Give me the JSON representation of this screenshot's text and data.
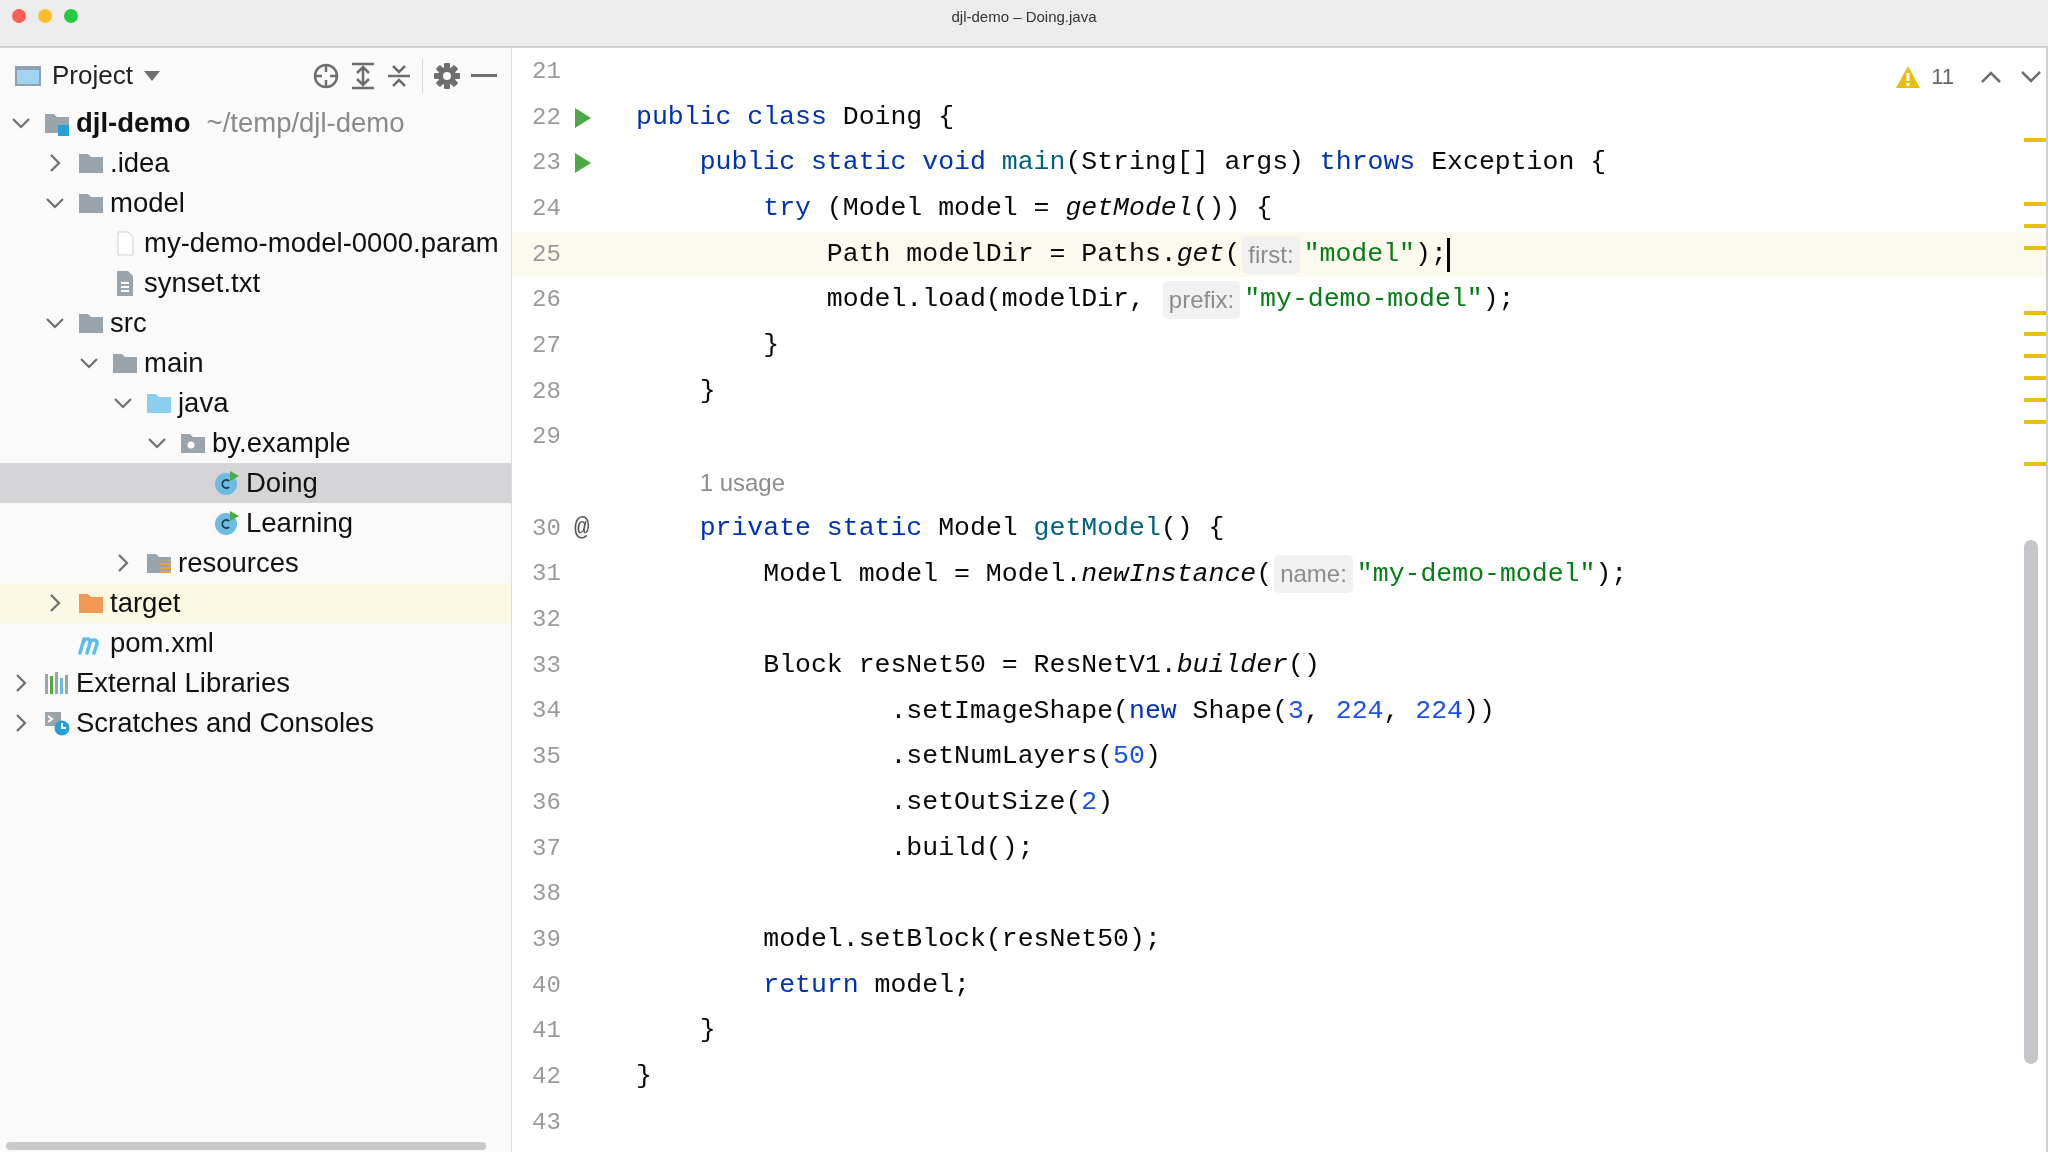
{
  "window": {
    "title": "djl-demo – Doing.java"
  },
  "project_panel": {
    "title": "Project",
    "tree": [
      {
        "label": "djl-demo",
        "kind": "module",
        "detail": "~/temp/djl-demo",
        "expanded": true,
        "selected": false,
        "highlighted": false,
        "children": [
          {
            "label": ".idea",
            "kind": "folder",
            "expanded": false,
            "selected": false,
            "highlighted": false
          },
          {
            "label": "model",
            "kind": "folder",
            "expanded": true,
            "selected": false,
            "highlighted": false,
            "children": [
              {
                "label": "my-demo-model-0000.param",
                "kind": "file",
                "selected": false,
                "highlighted": false
              },
              {
                "label": "synset.txt",
                "kind": "text-file",
                "selected": false,
                "highlighted": false
              }
            ]
          },
          {
            "label": "src",
            "kind": "folder",
            "expanded": true,
            "selected": false,
            "highlighted": false,
            "children": [
              {
                "label": "main",
                "kind": "folder",
                "expanded": true,
                "selected": false,
                "highlighted": false,
                "children": [
                  {
                    "label": "java",
                    "kind": "source-folder",
                    "expanded": true,
                    "selected": false,
                    "highlighted": false,
                    "children": [
                      {
                        "label": "by.example",
                        "kind": "package",
                        "expanded": true,
                        "selected": false,
                        "highlighted": false,
                        "children": [
                          {
                            "label": "Doing",
                            "kind": "class",
                            "selected": true,
                            "highlighted": false
                          },
                          {
                            "label": "Learning",
                            "kind": "class",
                            "selected": false,
                            "highlighted": false
                          }
                        ]
                      }
                    ]
                  },
                  {
                    "label": "resources",
                    "kind": "resources-folder",
                    "expanded": false,
                    "selected": false,
                    "highlighted": false
                  }
                ]
              }
            ]
          },
          {
            "label": "target",
            "kind": "excluded-folder",
            "expanded": false,
            "selected": false,
            "highlighted": true
          },
          {
            "label": "pom.xml",
            "kind": "maven",
            "selected": false,
            "highlighted": false
          }
        ]
      },
      {
        "label": "External Libraries",
        "kind": "libraries",
        "expanded": false,
        "selected": false,
        "highlighted": false
      },
      {
        "label": "Scratches and Consoles",
        "kind": "scratches",
        "expanded": false,
        "selected": false,
        "highlighted": false
      }
    ]
  },
  "editor": {
    "warnings": {
      "count": "11"
    },
    "lines": [
      {
        "kind": "code",
        "number": "21"
      },
      {
        "kind": "code",
        "number": "22",
        "gutter": {
          "kind": "run"
        },
        "segments": [
          {
            "kind": "code",
            "tokens": [
              {
                "kind": "kw",
                "t": "public class"
              },
              {
                "kind": "plain",
                "t": " Doing {"
              }
            ]
          }
        ]
      },
      {
        "kind": "code",
        "number": "23",
        "gutter": {
          "kind": "run"
        },
        "segments": [
          {
            "kind": "code",
            "tokens": [
              {
                "kind": "kw",
                "t": "    public static void "
              },
              {
                "kind": "fn",
                "t": "main"
              },
              {
                "kind": "plain",
                "t": "(String[] args) "
              },
              {
                "kind": "kw",
                "t": "throws"
              },
              {
                "kind": "plain",
                "t": " Exception {"
              }
            ]
          }
        ]
      },
      {
        "kind": "code",
        "number": "24",
        "segments": [
          {
            "kind": "code",
            "tokens": [
              {
                "kind": "kw",
                "t": "        try"
              },
              {
                "kind": "plain",
                "t": " (Model model = "
              },
              {
                "kind": "italic",
                "t": "getModel"
              },
              {
                "kind": "plain",
                "t": "()) {"
              }
            ]
          }
        ]
      },
      {
        "kind": "code",
        "number": "25",
        "current": true,
        "caret": true,
        "segments": [
          {
            "kind": "code",
            "tokens": [
              {
                "kind": "plain",
                "t": "            Path modelDir = Paths."
              },
              {
                "kind": "italic",
                "t": "get"
              },
              {
                "kind": "plain",
                "t": "("
              }
            ]
          },
          {
            "kind": "hint",
            "text": "first:"
          },
          {
            "kind": "code",
            "tokens": [
              {
                "kind": "str",
                "t": "\"model\""
              },
              {
                "kind": "plain",
                "t": ");"
              }
            ]
          }
        ]
      },
      {
        "kind": "code",
        "number": "26",
        "segments": [
          {
            "kind": "code",
            "tokens": [
              {
                "kind": "plain",
                "t": "            model.load(modelDir, "
              }
            ]
          },
          {
            "kind": "hint",
            "text": "prefix:"
          },
          {
            "kind": "code",
            "tokens": [
              {
                "kind": "str",
                "t": "\"my-demo-model\""
              },
              {
                "kind": "plain",
                "t": ");"
              }
            ]
          }
        ]
      },
      {
        "kind": "code",
        "number": "27",
        "segments": [
          {
            "kind": "code",
            "tokens": [
              {
                "kind": "plain",
                "t": "        }"
              }
            ]
          }
        ]
      },
      {
        "kind": "code",
        "number": "28",
        "segments": [
          {
            "kind": "code",
            "tokens": [
              {
                "kind": "plain",
                "t": "    }"
              }
            ]
          }
        ]
      },
      {
        "kind": "code",
        "number": "29"
      },
      {
        "kind": "usage",
        "text": "    1 usage"
      },
      {
        "kind": "code",
        "number": "30",
        "gutter": {
          "kind": "text",
          "text": "@"
        },
        "segments": [
          {
            "kind": "code",
            "tokens": [
              {
                "kind": "kw",
                "t": "    private static"
              },
              {
                "kind": "plain",
                "t": " Model "
              },
              {
                "kind": "fn",
                "t": "getModel"
              },
              {
                "kind": "plain",
                "t": "() {"
              }
            ]
          }
        ]
      },
      {
        "kind": "code",
        "number": "31",
        "segments": [
          {
            "kind": "code",
            "tokens": [
              {
                "kind": "plain",
                "t": "        Model model = Model."
              },
              {
                "kind": "italic",
                "t": "newInstance"
              },
              {
                "kind": "plain",
                "t": "("
              }
            ]
          },
          {
            "kind": "hint",
            "text": "name:"
          },
          {
            "kind": "code",
            "tokens": [
              {
                "kind": "str",
                "t": "\"my-demo-model\""
              },
              {
                "kind": "plain",
                "t": ");"
              }
            ]
          }
        ]
      },
      {
        "kind": "code",
        "number": "32"
      },
      {
        "kind": "code",
        "number": "33",
        "segments": [
          {
            "kind": "code",
            "tokens": [
              {
                "kind": "plain",
                "t": "        Block resNet50 = ResNetV1."
              },
              {
                "kind": "italic",
                "t": "builder"
              },
              {
                "kind": "plain",
                "t": "()"
              }
            ]
          }
        ]
      },
      {
        "kind": "code",
        "number": "34",
        "segments": [
          {
            "kind": "code",
            "tokens": [
              {
                "kind": "plain",
                "t": "                .setImageShape("
              },
              {
                "kind": "kw",
                "t": "new"
              },
              {
                "kind": "plain",
                "t": " Shape("
              },
              {
                "kind": "num",
                "t": "3"
              },
              {
                "kind": "plain",
                "t": ", "
              },
              {
                "kind": "num",
                "t": "224"
              },
              {
                "kind": "plain",
                "t": ", "
              },
              {
                "kind": "num",
                "t": "224"
              },
              {
                "kind": "plain",
                "t": "))"
              }
            ]
          }
        ]
      },
      {
        "kind": "code",
        "number": "35",
        "segments": [
          {
            "kind": "code",
            "tokens": [
              {
                "kind": "plain",
                "t": "                .setNumLayers("
              },
              {
                "kind": "num",
                "t": "50"
              },
              {
                "kind": "plain",
                "t": ")"
              }
            ]
          }
        ]
      },
      {
        "kind": "code",
        "number": "36",
        "segments": [
          {
            "kind": "code",
            "tokens": [
              {
                "kind": "plain",
                "t": "                .setOutSize("
              },
              {
                "kind": "num",
                "t": "2"
              },
              {
                "kind": "plain",
                "t": ")"
              }
            ]
          }
        ]
      },
      {
        "kind": "code",
        "number": "37",
        "segments": [
          {
            "kind": "code",
            "tokens": [
              {
                "kind": "plain",
                "t": "                .build();"
              }
            ]
          }
        ]
      },
      {
        "kind": "code",
        "number": "38"
      },
      {
        "kind": "code",
        "number": "39",
        "segments": [
          {
            "kind": "code",
            "tokens": [
              {
                "kind": "plain",
                "t": "        model.setBlock(resNet50);"
              }
            ]
          }
        ]
      },
      {
        "kind": "code",
        "number": "40",
        "segments": [
          {
            "kind": "code",
            "tokens": [
              {
                "kind": "kw",
                "t": "        return"
              },
              {
                "kind": "plain",
                "t": " model;"
              }
            ]
          }
        ]
      },
      {
        "kind": "code",
        "number": "41",
        "segments": [
          {
            "kind": "code",
            "tokens": [
              {
                "kind": "plain",
                "t": "    }"
              }
            ]
          }
        ]
      },
      {
        "kind": "code",
        "number": "42",
        "segments": [
          {
            "kind": "code",
            "tokens": [
              {
                "kind": "plain",
                "t": "}"
              }
            ]
          }
        ]
      },
      {
        "kind": "code",
        "number": "43"
      }
    ]
  }
}
